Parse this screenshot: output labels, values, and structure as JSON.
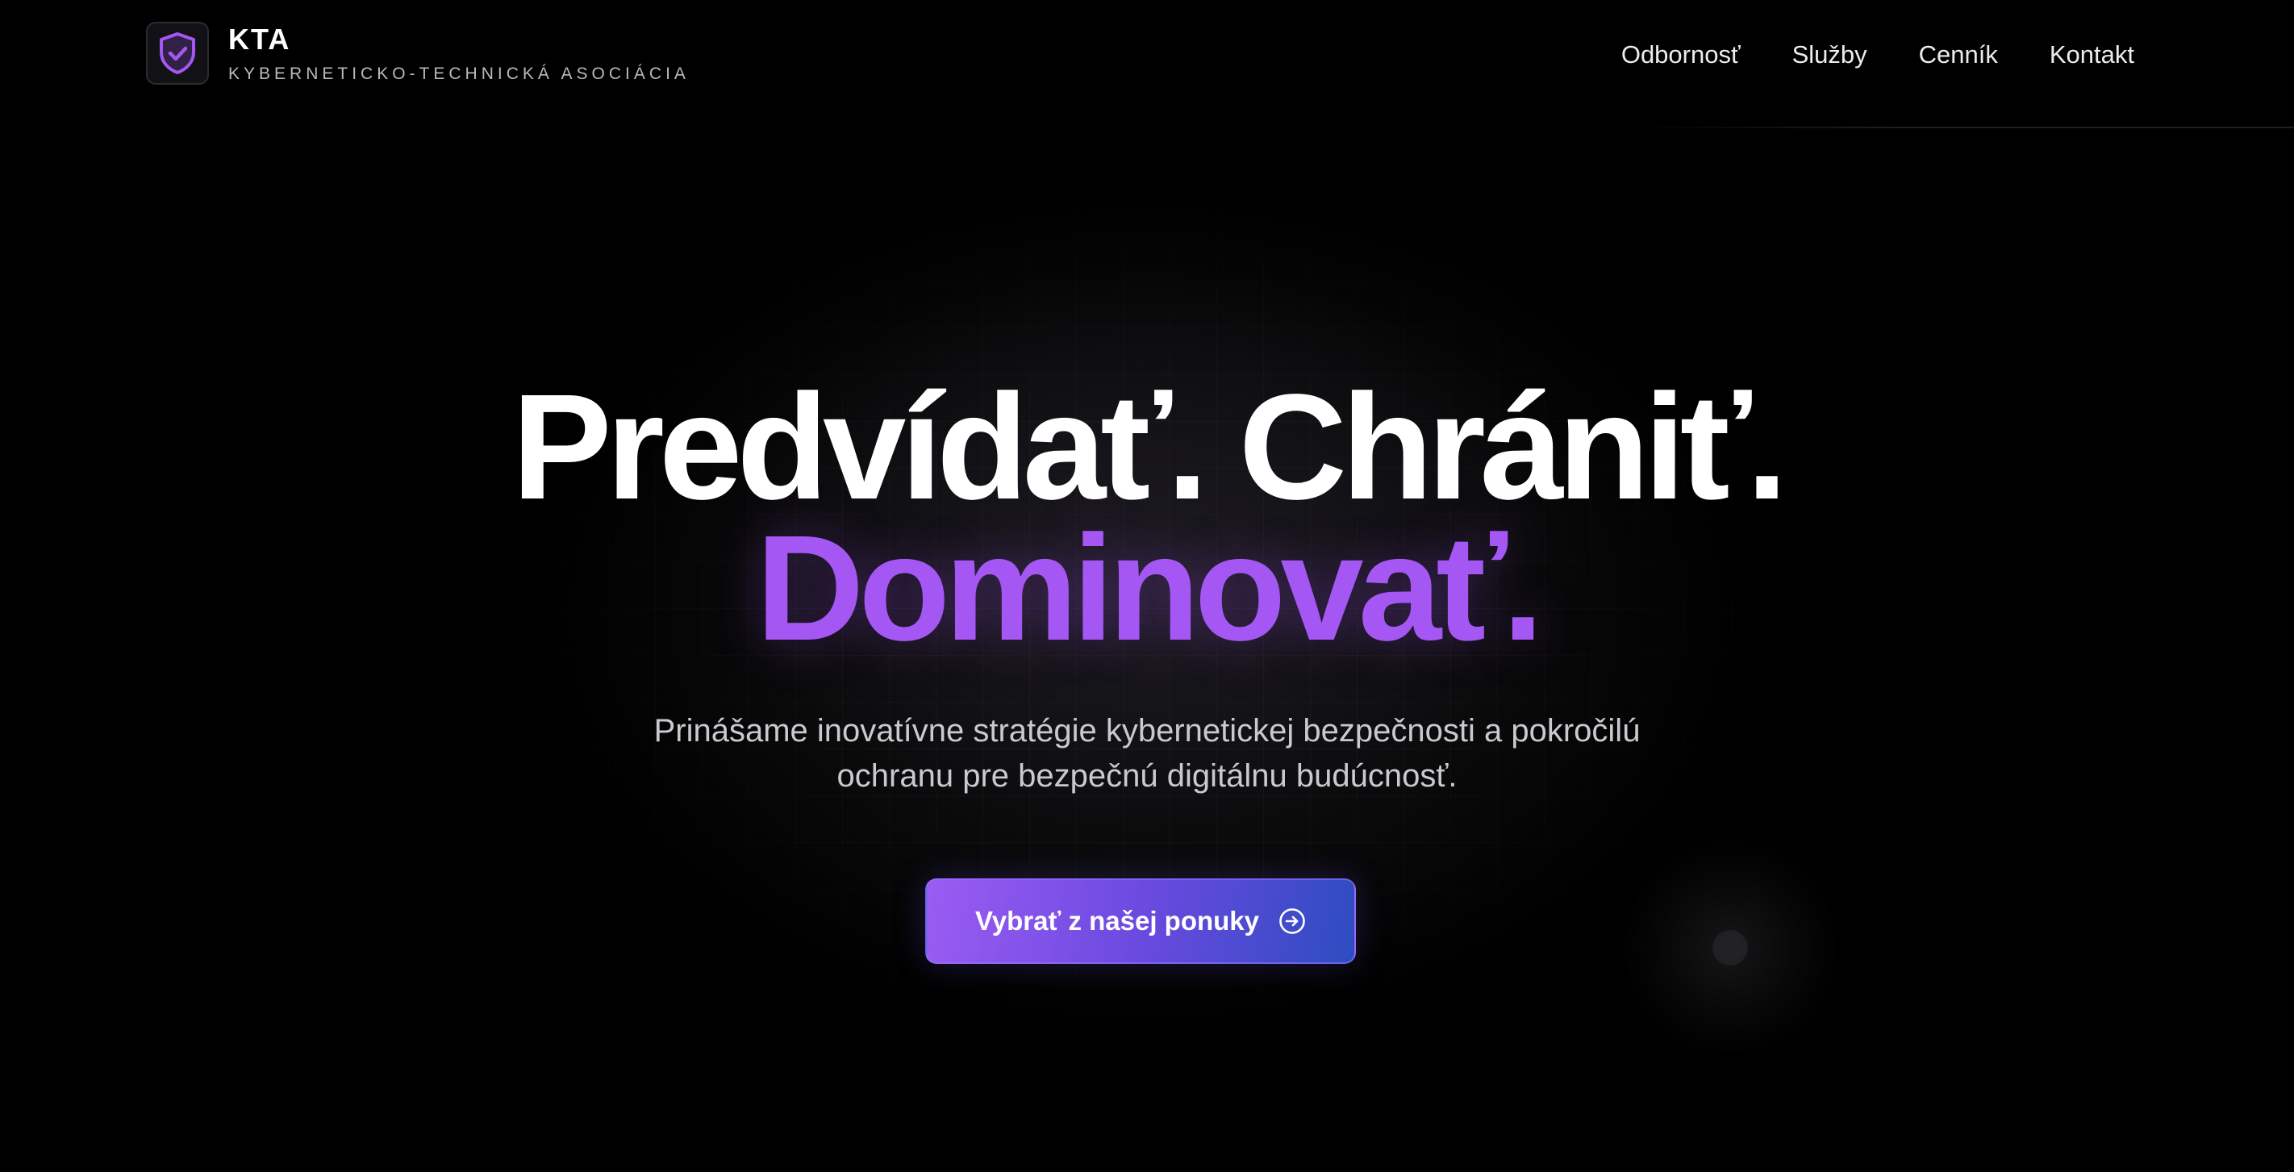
{
  "colors": {
    "background": "#000000",
    "accent": "#a457f3",
    "button_gradient_start": "#9b5cf3",
    "button_gradient_end": "#2d4cc0",
    "text_primary": "#ffffff",
    "text_secondary": "#c9c9cf"
  },
  "header": {
    "logo_icon": "shield-check-icon",
    "brand_name": "KTA",
    "brand_subtitle": "KYBERNETICKO-TECHNICKÁ ASOCIÁCIA",
    "nav": [
      {
        "label": "Odbornosť"
      },
      {
        "label": "Služby"
      },
      {
        "label": "Cenník"
      },
      {
        "label": "Kontakt"
      }
    ]
  },
  "hero": {
    "headline_line1": "Predvídať. Chrániť.",
    "headline_line2": "Dominovať.",
    "subtitle_line1": "Prinášame inovatívne stratégie kybernetickej bezpečnosti a pokročilú",
    "subtitle_line2": "ochranu pre bezpečnú digitálnu budúcnosť.",
    "cta_label": "Vybrať z našej ponuky",
    "cta_icon": "arrow-right-circle-icon"
  }
}
